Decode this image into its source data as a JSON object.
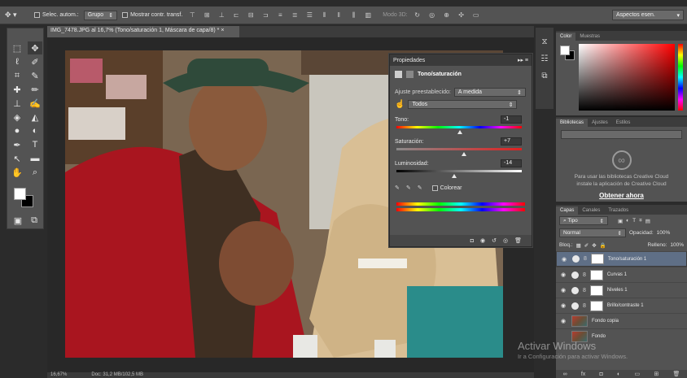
{
  "options_bar": {
    "auto_select_label": "Selec. autom.:",
    "group_select": "Grupo",
    "show_transform_label": "Mostrar contr. transf.",
    "mode_3d": "Modo 3D:",
    "workspace": "Aspectos esen."
  },
  "document": {
    "tab_title": "IMG_7478.JPG al 16,7% (Tono/saturación 1, Máscara de capa/8) *",
    "zoom": "16,67%",
    "doc_info": "Doc: 31,2 MB/102,5 MB"
  },
  "properties": {
    "panel_title": "Propiedades",
    "adjustment_name": "Tono/saturación",
    "preset_label": "Ajuste preestablecido:",
    "preset_value": "A medida",
    "channel_value": "Todos",
    "hue_label": "Tono:",
    "hue_value": "-1",
    "saturation_label": "Saturación:",
    "saturation_value": "+7",
    "lightness_label": "Luminosidad:",
    "lightness_value": "-14",
    "colorize_label": "Colorear"
  },
  "color_panel": {
    "tabs": [
      "Color",
      "Muestras"
    ]
  },
  "libraries_panel": {
    "tabs": [
      "Bibliotecas",
      "Ajustes",
      "Estilos"
    ],
    "message_line1": "Para usar las bibliotecas Creative Cloud",
    "message_line2": "instale la aplicación de Creative Cloud",
    "link": "Obtener ahora"
  },
  "layers_panel": {
    "tabs": [
      "Capas",
      "Canales",
      "Trazados"
    ],
    "kind_filter": "Tipo",
    "blend_mode": "Normal",
    "opacity_label": "Opacidad:",
    "opacity_value": "100%",
    "lock_label": "Bloq.:",
    "fill_label": "Relleno:",
    "fill_value": "100%",
    "layers": [
      {
        "name": "Tono/saturación 1",
        "selected": true
      },
      {
        "name": "Curvas 1",
        "selected": false
      },
      {
        "name": "Niveles 1",
        "selected": false
      },
      {
        "name": "Brillo/contraste 1",
        "selected": false
      },
      {
        "name": "Fondo copia",
        "selected": false
      },
      {
        "name": "Fondo",
        "selected": false
      }
    ]
  },
  "watermark": {
    "line1": "Activar Windows",
    "line2": "Ir a Configuración para activar Windows."
  }
}
